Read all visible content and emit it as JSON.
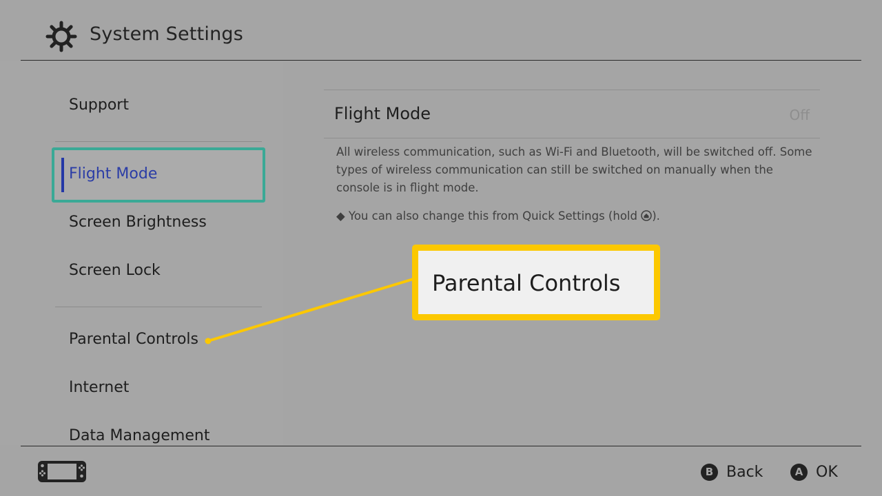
{
  "header": {
    "icon": "gear-icon",
    "title": "System Settings"
  },
  "sidebar": {
    "items": [
      {
        "label": "Support"
      },
      {
        "label": "Flight Mode",
        "selected": true
      },
      {
        "label": "Screen Brightness"
      },
      {
        "label": "Screen Lock"
      },
      {
        "label": "Parental Controls"
      },
      {
        "label": "Internet"
      },
      {
        "label": "Data Management"
      }
    ]
  },
  "content": {
    "setting_title": "Flight Mode",
    "setting_value": "Off",
    "description": "All wireless communication, such as Wi-Fi and Bluetooth, will be switched off. Some types of wireless communication can still be switched on manually when the console is in flight mode.",
    "note_prefix": "◆ You can also change this from Quick Settings (hold ",
    "note_icon": "home-button-icon",
    "note_suffix": ")."
  },
  "callout": {
    "text": "Parental Controls",
    "color": "#fcc800"
  },
  "footer": {
    "console_icon": "console-icon",
    "back": {
      "glyph": "B",
      "label": "Back"
    },
    "ok": {
      "glyph": "A",
      "label": "OK"
    }
  },
  "colors": {
    "selection_border": "#3aa996",
    "selection_text": "#2b3da6",
    "background": "#a5a5a5"
  }
}
